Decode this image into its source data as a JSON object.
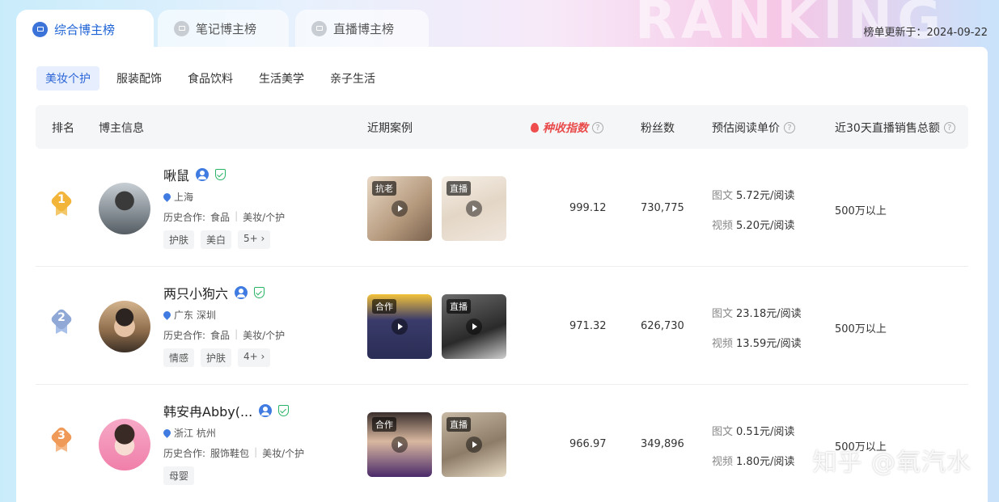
{
  "background_word": "RANKING",
  "tabs": [
    {
      "label": "综合博主榜",
      "icon": "chart-icon",
      "active": true
    },
    {
      "label": "笔记博主榜",
      "icon": "note-icon",
      "active": false
    },
    {
      "label": "直播博主榜",
      "icon": "live-icon",
      "active": false
    }
  ],
  "update_text": "榜单更新于：2024-09-22",
  "categories": [
    {
      "label": "美妆个护",
      "active": true
    },
    {
      "label": "服装配饰",
      "active": false
    },
    {
      "label": "食品饮料",
      "active": false
    },
    {
      "label": "生活美学",
      "active": false
    },
    {
      "label": "亲子生活",
      "active": false
    }
  ],
  "columns": {
    "rank": "排名",
    "blogger": "博主信息",
    "cases": "近期案例",
    "index": "种收指数",
    "fans": "粉丝数",
    "price": "预估阅读单价",
    "sales": "近30天直播销售总额",
    "help": "?"
  },
  "rows": [
    {
      "rank": "1",
      "name": "啾鼠",
      "location": "上海",
      "history_label": "历史合作:",
      "history": [
        "食品",
        "美妆/个护"
      ],
      "tags": [
        "护肤",
        "美白",
        "5+ ›"
      ],
      "cases": [
        {
          "badge": "抗老"
        },
        {
          "badge": "直播"
        }
      ],
      "index": "999.12",
      "fans": "730,775",
      "price_image_label": "图文",
      "price_image": "5.72元/阅读",
      "price_video_label": "视频",
      "price_video": "5.20元/阅读",
      "sales": "500万以上"
    },
    {
      "rank": "2",
      "name": "两只小狗六",
      "location": "广东 深圳",
      "history_label": "历史合作:",
      "history": [
        "食品",
        "美妆/个护"
      ],
      "tags": [
        "情感",
        "护肤",
        "4+ ›"
      ],
      "cases": [
        {
          "badge": "合作"
        },
        {
          "badge": "直播"
        }
      ],
      "index": "971.32",
      "fans": "626,730",
      "price_image_label": "图文",
      "price_image": "23.18元/阅读",
      "price_video_label": "视频",
      "price_video": "13.59元/阅读",
      "sales": "500万以上"
    },
    {
      "rank": "3",
      "name": "韩安冉Abby(...",
      "location": "浙江 杭州",
      "history_label": "历史合作:",
      "history": [
        "服饰鞋包",
        "美妆/个护"
      ],
      "tags": [
        "母婴"
      ],
      "cases": [
        {
          "badge": "合作"
        },
        {
          "badge": "直播"
        }
      ],
      "index": "966.97",
      "fans": "349,896",
      "price_image_label": "图文",
      "price_image": "0.51元/阅读",
      "price_video_label": "视频",
      "price_video": "1.80元/阅读",
      "sales": "500万以上"
    }
  ],
  "watermark": "知乎 @氧汽水",
  "colors": {
    "accent": "#2a64d6",
    "hot": "#e94b4b",
    "verified": "#28b466"
  }
}
